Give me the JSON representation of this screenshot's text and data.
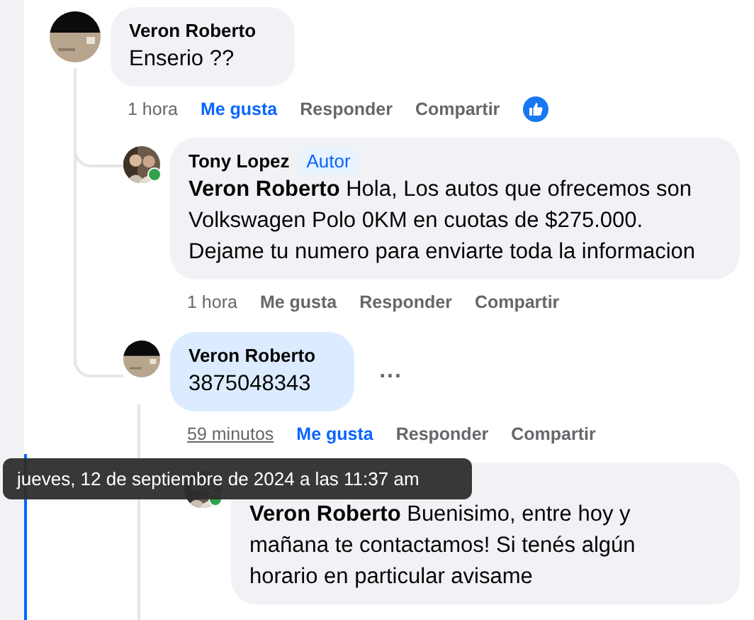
{
  "comments": [
    {
      "author": "Veron Roberto",
      "text": "Enserio ??",
      "online": false,
      "highlighted": false,
      "actions": {
        "time": "1 hora",
        "time_hovered": false,
        "like": "Me gusta",
        "liked": true,
        "reply": "Responder",
        "share": "Compartir"
      },
      "reacted": true,
      "children": [
        {
          "author": "Tony Lopez",
          "badge": "Autor",
          "text": "**Veron Roberto** Hola, Los autos que ofrecemos son Volkswagen Polo 0KM en cuotas de $275.000. Dejame tu numero para enviarte toda la informacion",
          "online": true,
          "highlighted": false,
          "actions": {
            "time": "1 hora",
            "time_hovered": false,
            "like": "Me gusta",
            "liked": false,
            "reply": "Responder",
            "share": "Compartir"
          },
          "reacted": false
        },
        {
          "author": "Veron Roberto",
          "text": "3875048343",
          "online": false,
          "highlighted": true,
          "more": "...",
          "actions": {
            "time": "59 minutos",
            "time_hovered": true,
            "like": "Me gusta",
            "liked": true,
            "reply": "Responder",
            "share": "Compartir"
          },
          "reacted": false,
          "children": [
            {
              "text": "**Veron Roberto** Buenisimo, entre hoy y mañana te contactamos! Si tenés algún horario en particular avisame",
              "online": true,
              "highlighted": false
            }
          ]
        }
      ]
    }
  ],
  "tooltip": {
    "text": "jueves, 12 de septiembre de 2024 a las 11:37 am"
  }
}
